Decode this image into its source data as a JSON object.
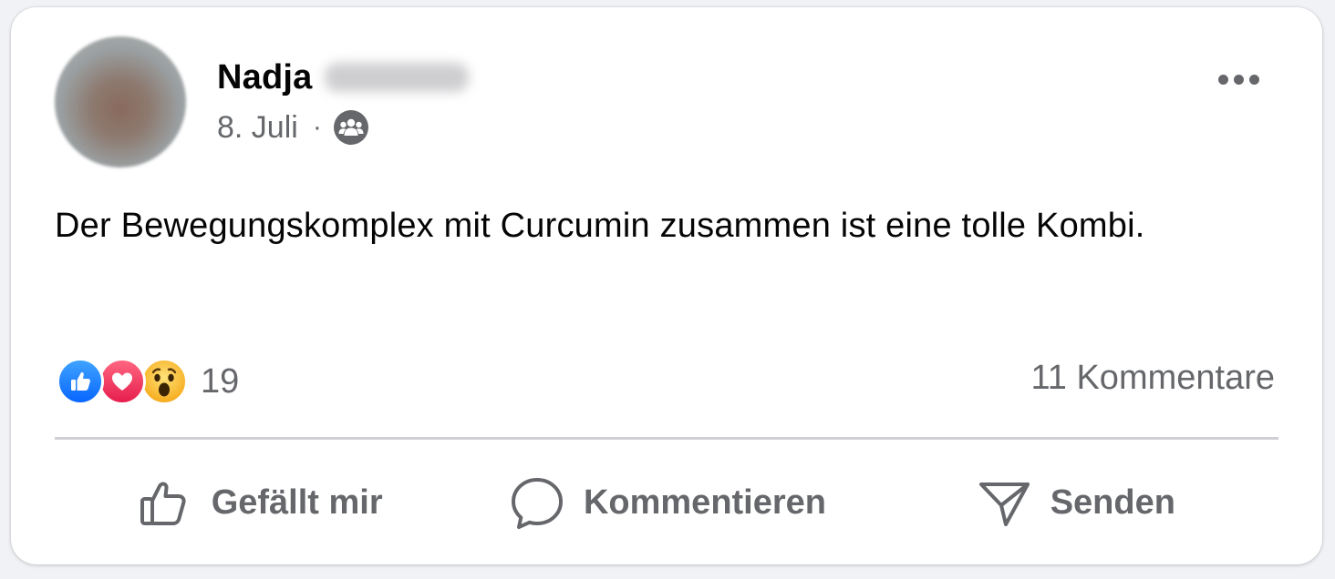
{
  "post": {
    "author": {
      "first_name": "Nadja",
      "avatar": "profile-photo"
    },
    "date": "8. Juli",
    "separator": "·",
    "audience_icon": "friends-icon",
    "menu_icon": "more-options-icon",
    "text": "Der Bewegungskomplex mit Curcumin zusammen ist eine tolle Kombi."
  },
  "reactions": {
    "icons": [
      "like-reaction-icon",
      "love-reaction-icon",
      "wow-reaction-icon"
    ],
    "count": "19"
  },
  "comments": {
    "count_label": "11 Kommentare"
  },
  "actions": {
    "like_label": "Gefällt mir",
    "comment_label": "Kommentieren",
    "send_label": "Senden"
  },
  "colors": {
    "card_bg": "#ffffff",
    "secondary_text": "#65676b",
    "primary_text": "#050505",
    "like_blue": "#0866ff",
    "love_red": "#e61e4d",
    "wow_yellow": "#f7b125",
    "divider": "#ced0d4"
  }
}
